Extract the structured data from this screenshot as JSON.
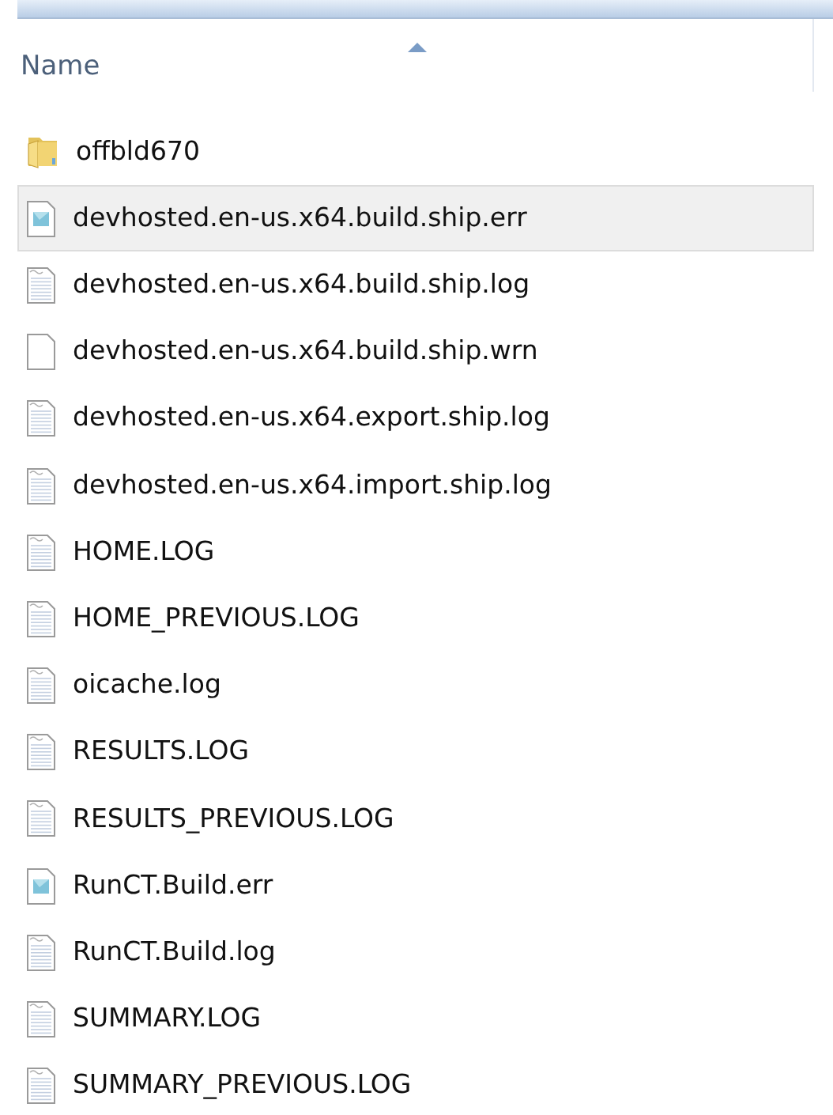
{
  "column_header": {
    "label": "Name",
    "sorted_ascending": true
  },
  "files": [
    {
      "name": "offbld670",
      "kind": "folder",
      "selected": false
    },
    {
      "name": "devhosted.en-us.x64.build.ship.err",
      "kind": "err",
      "selected": true
    },
    {
      "name": "devhosted.en-us.x64.build.ship.log",
      "kind": "log",
      "selected": false
    },
    {
      "name": "devhosted.en-us.x64.build.ship.wrn",
      "kind": "blank",
      "selected": false
    },
    {
      "name": "devhosted.en-us.x64.export.ship.log",
      "kind": "log",
      "selected": false
    },
    {
      "name": "devhosted.en-us.x64.import.ship.log",
      "kind": "log",
      "selected": false
    },
    {
      "name": "HOME.LOG",
      "kind": "log",
      "selected": false
    },
    {
      "name": "HOME_PREVIOUS.LOG",
      "kind": "log",
      "selected": false
    },
    {
      "name": "oicache.log",
      "kind": "log",
      "selected": false
    },
    {
      "name": "RESULTS.LOG",
      "kind": "log",
      "selected": false
    },
    {
      "name": "RESULTS_PREVIOUS.LOG",
      "kind": "log",
      "selected": false
    },
    {
      "name": "RunCT.Build.err",
      "kind": "err",
      "selected": false
    },
    {
      "name": "RunCT.Build.log",
      "kind": "log",
      "selected": false
    },
    {
      "name": "SUMMARY.LOG",
      "kind": "log",
      "selected": false
    },
    {
      "name": "SUMMARY_PREVIOUS.LOG",
      "kind": "log",
      "selected": false
    }
  ]
}
